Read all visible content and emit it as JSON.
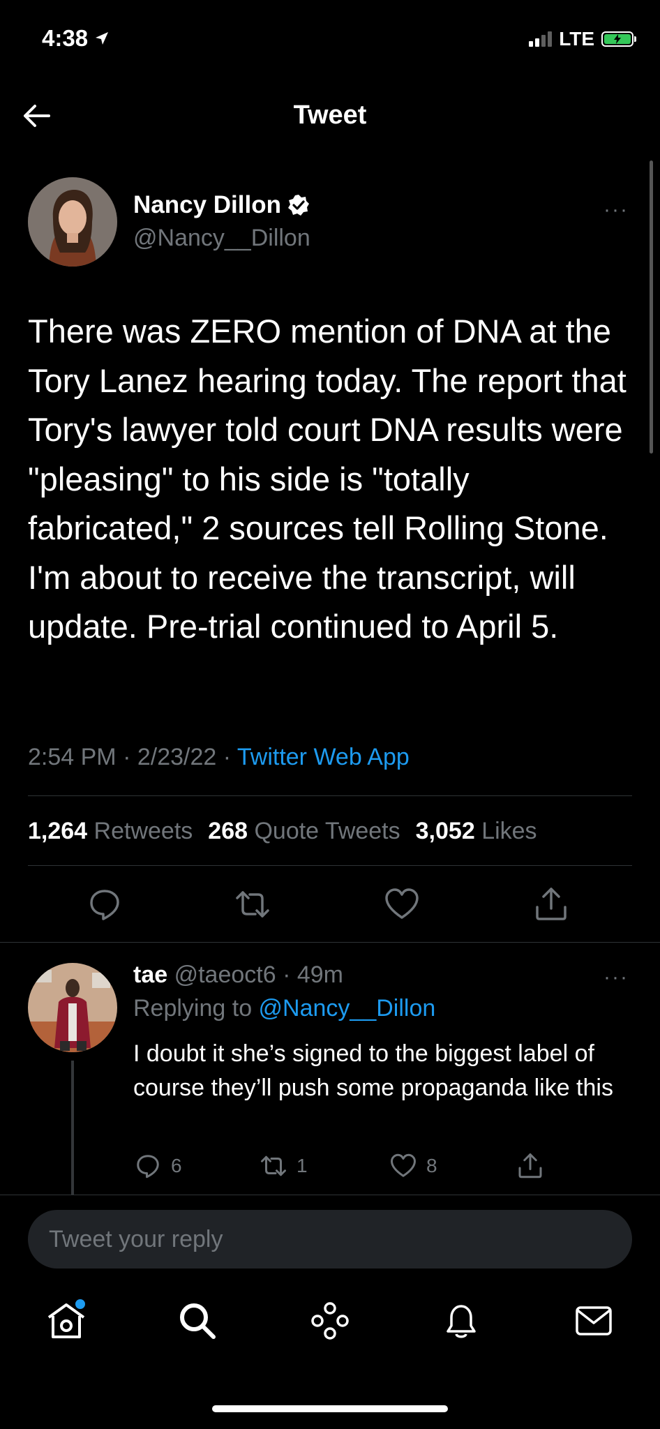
{
  "status_bar": {
    "time": "4:38",
    "network": "LTE"
  },
  "header": {
    "title": "Tweet"
  },
  "tweet": {
    "author_name": "Nancy Dillon",
    "author_handle": "@Nancy__Dillon",
    "more": "···",
    "text": "There was ZERO mention of DNA at the Tory Lanez hearing today. The report that Tory's lawyer told court DNA results were \"pleasing\" to his side is \"totally fabricated,\" 2 sources tell Rolling Stone. I'm about to receive the transcript, will update. Pre-trial continued to April 5.",
    "timestamp": "2:54 PM · 2/23/22 · ",
    "source": "Twitter Web App",
    "retweets_count": "1,264",
    "retweets_label": "Retweets",
    "quotes_count": "268",
    "quotes_label": "Quote Tweets",
    "likes_count": "3,052",
    "likes_label": "Likes"
  },
  "reply": {
    "author_name": "tae",
    "author_handle": "@taeoct6",
    "time": " · 49m",
    "more": "···",
    "replying_prefix": "Replying to ",
    "replying_handle": "@Nancy__Dillon",
    "text": "I doubt it she’s signed to the biggest label of course they’ll push some propaganda like this",
    "reply_count": "6",
    "retweet_count": "1",
    "like_count": "8"
  },
  "composer": {
    "placeholder": "Tweet your reply"
  },
  "colors": {
    "accent": "#1d9bf0",
    "background": "#000000",
    "muted": "#71767b"
  }
}
